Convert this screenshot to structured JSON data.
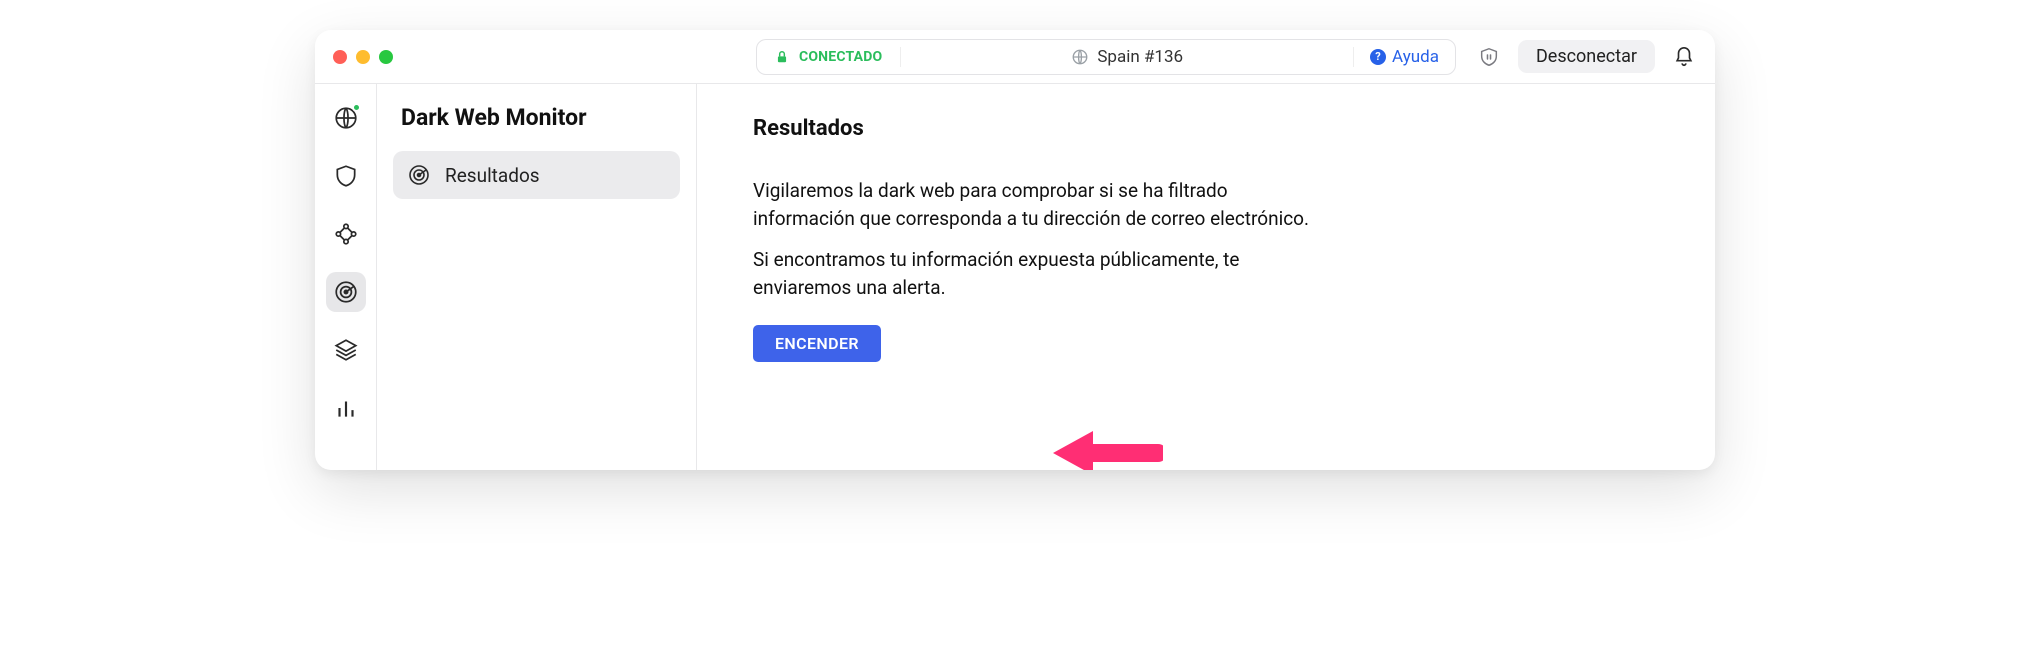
{
  "titlebar": {
    "status_label": "CONECTADO",
    "server_label": "Spain #136",
    "help_label": "Ayuda",
    "disconnect_label": "Desconectar"
  },
  "sidebar": {
    "title": "Dark Web Monitor",
    "item_results_label": "Resultados"
  },
  "rail": {
    "items": [
      {
        "name": "globe"
      },
      {
        "name": "shield"
      },
      {
        "name": "mesh"
      },
      {
        "name": "radar"
      },
      {
        "name": "layers"
      },
      {
        "name": "stats"
      }
    ],
    "active_index": 3
  },
  "main": {
    "heading": "Resultados",
    "para1": "Vigilaremos la dark web para comprobar si se ha filtrado información que corresponda a tu dirección de correo electrónico.",
    "para2": "Si encontramos tu información expuesta públicamente, te enviaremos una alerta.",
    "button_label": "ENCENDER"
  },
  "colors": {
    "accent_blue": "#3e63ea",
    "link_blue": "#2761e8",
    "connected_green": "#2bbd5c"
  }
}
